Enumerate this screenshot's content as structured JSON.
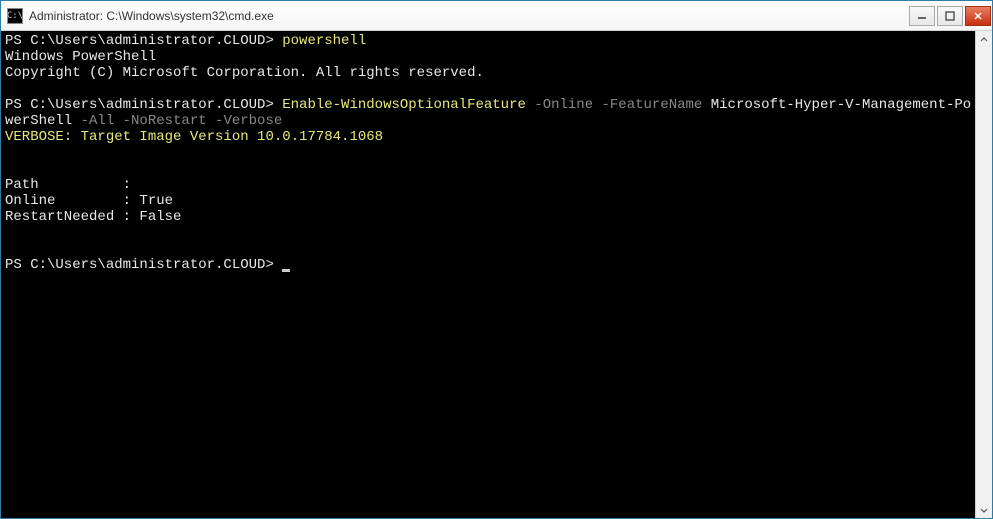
{
  "titlebar": {
    "icon_label": "C:\\",
    "title": "Administrator: C:\\Windows\\system32\\cmd.exe"
  },
  "terminal": {
    "prompt1": "PS C:\\Users\\administrator.CLOUD> ",
    "cmd1": "powershell",
    "line_ps_header": "Windows PowerShell",
    "line_copyright": "Copyright (C) Microsoft Corporation. All rights reserved.",
    "prompt2": "PS C:\\Users\\administrator.CLOUD> ",
    "cmd2_cmdlet": "Enable-WindowsOptionalFeature",
    "cmd2_params_gray1": " -Online -FeatureName ",
    "cmd2_value": "Microsoft-Hyper-V-Management-PowerShell",
    "cmd2_params_gray2": " -All -NoRestart -Verbose",
    "verbose_line": "VERBOSE: Target Image Version 10.0.17784.1068",
    "result_path": "Path          :",
    "result_online": "Online        : True",
    "result_restart": "RestartNeeded : False",
    "prompt3": "PS C:\\Users\\administrator.CLOUD> "
  }
}
